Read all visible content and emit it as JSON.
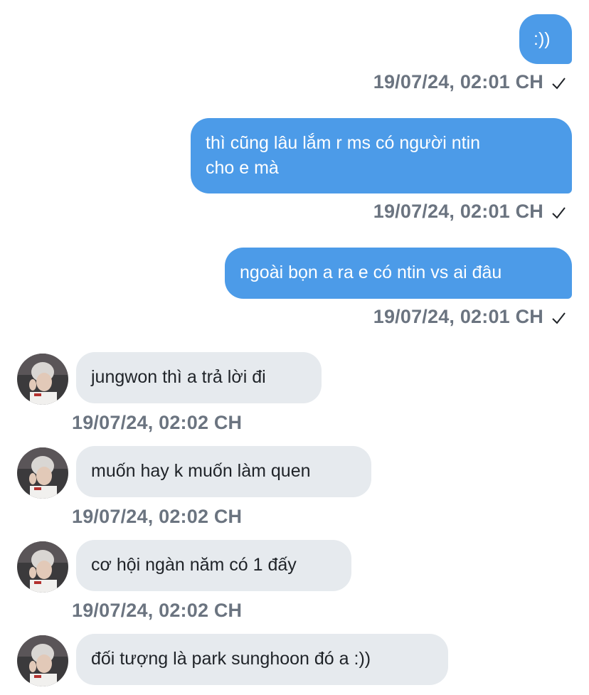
{
  "messages": [
    {
      "side": "out",
      "text": ":))",
      "time": "19/07/24, 02:01 CH",
      "read": true
    },
    {
      "side": "out",
      "text": "thì cũng lâu lắm r ms có người ntin cho e mà",
      "line1": "thì cũng lâu lắm r ms có người ntin",
      "line2": "cho e mà",
      "time": "19/07/24, 02:01 CH",
      "read": true
    },
    {
      "side": "out",
      "text": "ngoài bọn a ra e có ntin vs ai đâu",
      "time": "19/07/24, 02:01 CH",
      "read": true
    },
    {
      "side": "in",
      "text": "jungwon thì a trả lời đi",
      "time": "19/07/24, 02:02 CH"
    },
    {
      "side": "in",
      "text": "muốn hay k muốn làm quen",
      "time": "19/07/24, 02:02 CH"
    },
    {
      "side": "in",
      "text": "cơ hội ngàn năm có 1 đấy",
      "time": "19/07/24, 02:02 CH"
    },
    {
      "side": "in",
      "text": "đối tượng là park sunghoon đó a :))"
    }
  ],
  "colors": {
    "outgoing_bubble": "#4c9be8",
    "incoming_bubble": "#e6eaee",
    "timestamp": "#6b7480"
  },
  "icons": {
    "read_receipt": "checkmark-icon",
    "avatar": "user-avatar"
  }
}
